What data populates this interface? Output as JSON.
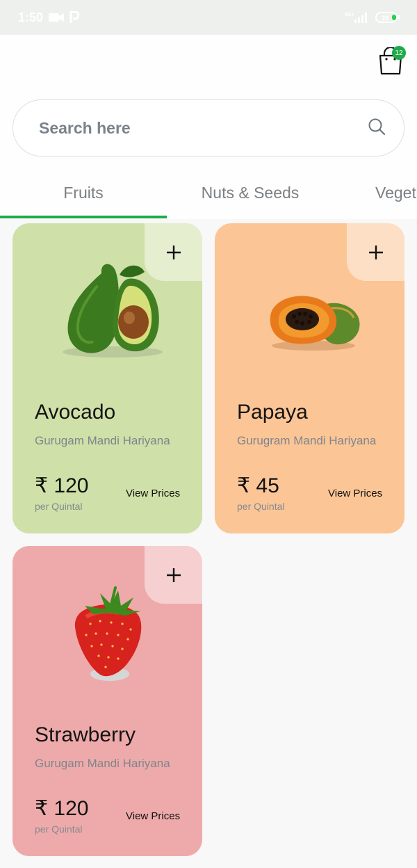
{
  "status": {
    "time": "1:50",
    "network": "4G+",
    "battery": "39"
  },
  "search": {
    "placeholder": "Search here"
  },
  "cart": {
    "count": "12"
  },
  "tabs": [
    {
      "label": "Fruits"
    },
    {
      "label": "Nuts & Seeds"
    },
    {
      "label": "Veget"
    }
  ],
  "products": [
    {
      "name": "Avocado",
      "location": "Gurugam Mandi Hariyana",
      "price": "₹ 120",
      "unit": "per Quintal",
      "action": "View Prices",
      "add": "+",
      "bg": "#cfe0a8"
    },
    {
      "name": "Papaya",
      "location": "Gurugram Mandi Hariyana",
      "price": "₹ 45",
      "unit": "per Quintal",
      "action": "View Prices",
      "add": "+",
      "bg": "#fbc596"
    },
    {
      "name": "Strawberry",
      "location": "Gurugam Mandi Hariyana",
      "price": "₹ 120",
      "unit": "per Quintal",
      "action": "View Prices",
      "add": "+",
      "bg": "#eeaaaa"
    }
  ],
  "colors": {
    "accent": "#1faa4a"
  }
}
